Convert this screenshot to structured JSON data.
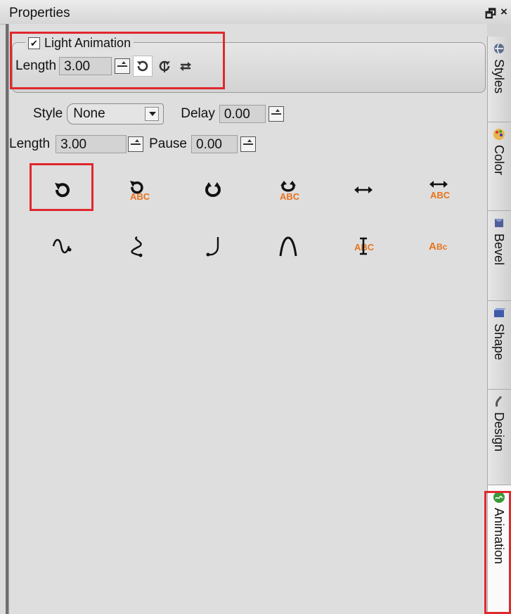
{
  "titlebar": {
    "title": "Properties",
    "restore_glyph": "🗗",
    "close_glyph": "×"
  },
  "light_animation": {
    "checkbox_checked": true,
    "label": "Light Animation",
    "length_label": "Length",
    "length_value": "3.00",
    "mode_icons": [
      "rotate-ccw-icon",
      "rotate-cw-icon",
      "loop-arrows-icon"
    ]
  },
  "animation": {
    "style_label": "Style",
    "style_value": "None",
    "delay_label": "Delay",
    "delay_value": "0.00",
    "length_label": "Length",
    "length_value": "3.00",
    "pause_label": "Pause",
    "pause_value": "0.00",
    "effects_row1": [
      "rotate",
      "rotate-text",
      "spin",
      "spin-text",
      "horizontal",
      "horizontal-text"
    ],
    "effects_row2": [
      "wave",
      "s-curve",
      "hook",
      "arch",
      "vertical-text",
      "scale-text"
    ],
    "text_sample": "ABC",
    "scale_text": "ABc",
    "accent_color": "#e8731c"
  },
  "tabs": [
    {
      "label": "Styles",
      "icon": "globe-icon"
    },
    {
      "label": "Color",
      "icon": "palette-icon"
    },
    {
      "label": "Bevel",
      "icon": "bevel-icon"
    },
    {
      "label": "Shape",
      "icon": "shape-icon"
    },
    {
      "label": "Design",
      "icon": "brush-icon"
    },
    {
      "label": "Animation",
      "icon": "animation-icon",
      "active": true
    }
  ]
}
